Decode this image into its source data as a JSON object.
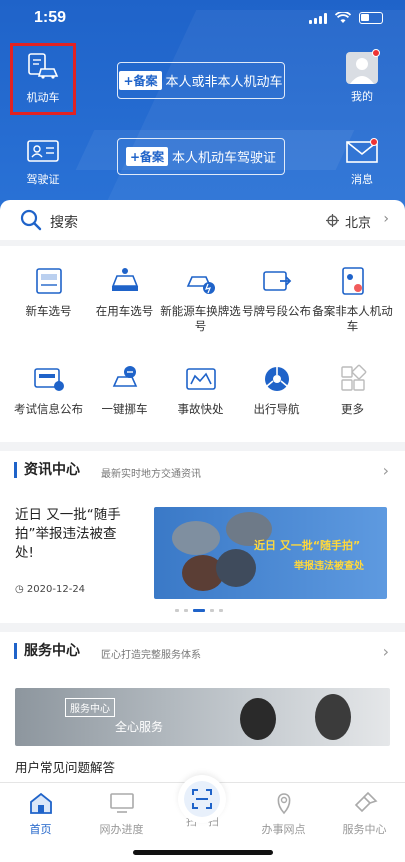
{
  "status_bar": {
    "time": "1:59"
  },
  "header": {
    "left_top_label": "机动车",
    "left_bottom_label": "驾驶证",
    "pill1_tag": "+备案",
    "pill1_text": "本人或非本人机动车",
    "pill2_tag": "+备案",
    "pill2_text": "本人机动车驾驶证",
    "right_top_label": "我的",
    "right_bottom_label": "消息"
  },
  "search": {
    "label": "搜索",
    "city": "北京"
  },
  "grid": [
    {
      "label": "新车选号",
      "icon": "new-car-number-icon"
    },
    {
      "label": "在用车选号",
      "icon": "used-car-number-icon"
    },
    {
      "label": "新能源车换牌选号",
      "icon": "ev-plate-icon"
    },
    {
      "label": "号牌号段公布",
      "icon": "plate-segment-icon"
    },
    {
      "label": "备案非本人机动车",
      "icon": "register-vehicle-icon"
    },
    {
      "label": "考试信息公布",
      "icon": "exam-info-icon"
    },
    {
      "label": "一键挪车",
      "icon": "move-car-icon"
    },
    {
      "label": "事故快处",
      "icon": "accident-icon"
    },
    {
      "label": "出行导航",
      "icon": "navigation-icon"
    },
    {
      "label": "更多",
      "icon": "more-icon"
    }
  ],
  "news": {
    "title": "资讯中心",
    "subtitle": "最新实时地方交通资讯",
    "headline": "近日 又一批“随手拍”举报违法被查处!",
    "date": "2020-12-24",
    "image_title1": "近日 又一批“随手拍”",
    "image_title2": "举报违法被查处"
  },
  "services": {
    "title": "服务中心",
    "subtitle": "匠心打造完整服务体系",
    "banner_badge": "服务中心",
    "banner_text": "全心服务",
    "faq": "用户常见问题解答"
  },
  "tabbar": [
    {
      "label": "首页",
      "icon": "home-icon",
      "active": true
    },
    {
      "label": "网办进度",
      "icon": "monitor-icon",
      "active": false
    },
    {
      "label": "扫一扫",
      "icon": "scan-icon",
      "active": false
    },
    {
      "label": "办事网点",
      "icon": "location-icon",
      "active": false
    },
    {
      "label": "服务中心",
      "icon": "service-icon",
      "active": false
    }
  ],
  "colors": {
    "primary": "#1f63c9",
    "highlight": "#e12222"
  }
}
